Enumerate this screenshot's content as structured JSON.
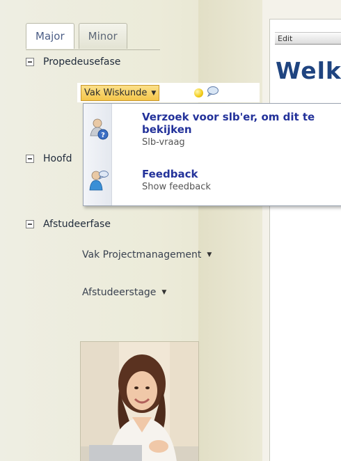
{
  "tabs": [
    {
      "label": "Major",
      "active": true
    },
    {
      "label": "Minor",
      "active": false
    }
  ],
  "tree": {
    "propedeuse": {
      "label": "Propedeusefase",
      "course_selected": "Vak Wiskunde"
    },
    "hoofdfase": {
      "label": "Hoofd"
    },
    "afstudeerfase": {
      "label": "Afstudeerfase",
      "courses": [
        "Vak Projectmanagement",
        "Afstudeerstage"
      ]
    }
  },
  "context_menu": {
    "items": [
      {
        "title_line1": "Verzoek voor slb'er, om dit te",
        "title_line2": "bekijken",
        "subtitle": "Slb-vraag",
        "icon": "user-help-icon"
      },
      {
        "title_line1": "Feedback",
        "subtitle": "Show feedback",
        "icon": "user-feedback-icon"
      }
    ]
  },
  "content": {
    "edit_label": "Edit",
    "heading": "Welk"
  },
  "colors": {
    "selected_course_bg": "#f5c64a",
    "menu_title": "#23329a",
    "heading": "#1f4480"
  }
}
